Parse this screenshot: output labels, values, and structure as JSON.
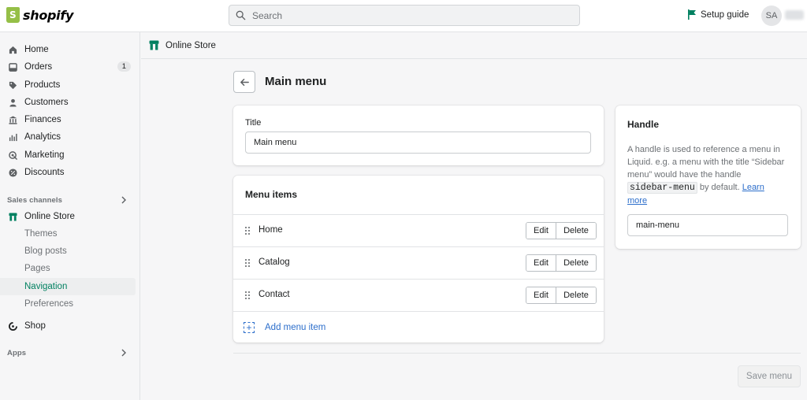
{
  "topbar": {
    "brand": "shopify",
    "search_placeholder": "Search",
    "setup_guide": "Setup guide",
    "avatar_initials": "SA"
  },
  "sidebar": {
    "items": [
      {
        "label": "Home",
        "icon": "home-icon"
      },
      {
        "label": "Orders",
        "icon": "orders-icon",
        "badge": "1"
      },
      {
        "label": "Products",
        "icon": "tag-icon"
      },
      {
        "label": "Customers",
        "icon": "person-icon"
      },
      {
        "label": "Finances",
        "icon": "bank-icon"
      },
      {
        "label": "Analytics",
        "icon": "bar-chart-icon"
      },
      {
        "label": "Marketing",
        "icon": "target-icon"
      },
      {
        "label": "Discounts",
        "icon": "discount-icon"
      }
    ],
    "sales_channels_label": "Sales channels",
    "online_store": "Online Store",
    "online_store_sub": [
      "Themes",
      "Blog posts",
      "Pages",
      "Navigation",
      "Preferences"
    ],
    "shop": "Shop",
    "apps_label": "Apps"
  },
  "breadcrumb": "Online Store",
  "page": {
    "title": "Main menu",
    "title_field_label": "Title",
    "title_field_value": "Main menu",
    "menu_items_heading": "Menu items",
    "menu_items": [
      {
        "label": "Home"
      },
      {
        "label": "Catalog"
      },
      {
        "label": "Contact"
      }
    ],
    "edit_label": "Edit",
    "delete_label": "Delete",
    "add_menu_item": "Add menu item",
    "save_button": "Save menu"
  },
  "handle": {
    "heading": "Handle",
    "text_before": "A handle is used to reference a menu in Liquid. e.g. a menu with the title “Sidebar menu” would have the handle ",
    "code": "sidebar-menu",
    "text_after": " by default. ",
    "link": "Learn more",
    "value": "main-menu"
  },
  "colors": {
    "accent_green": "#008060",
    "link_blue": "#2c6ecb",
    "brand_green": "#95bf47"
  }
}
